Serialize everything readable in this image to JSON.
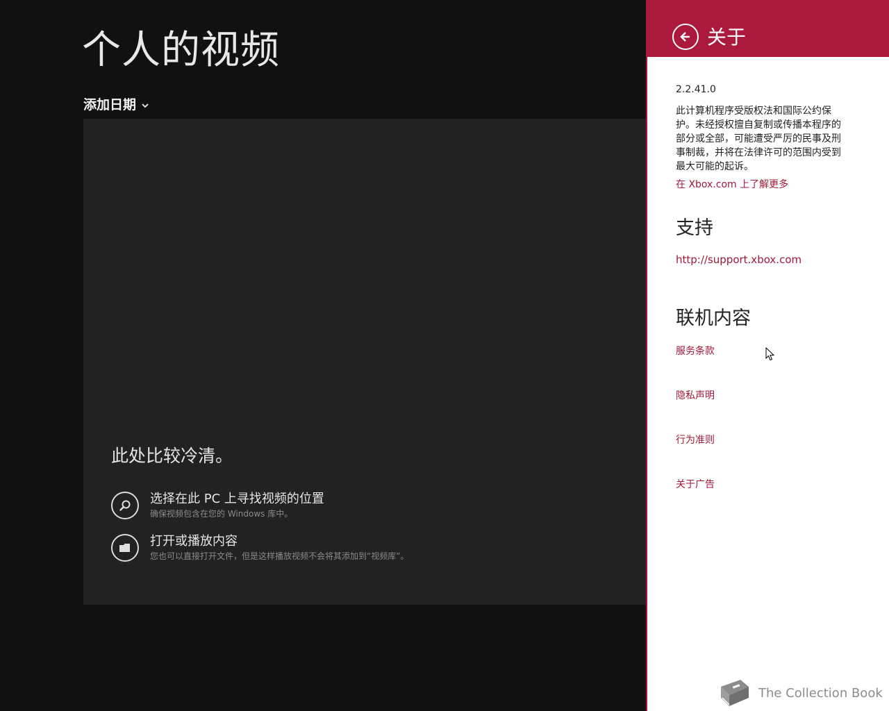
{
  "app": {
    "page_title": "个人的视频",
    "sort_label": "添加日期",
    "empty_state": {
      "title": "此处比较冷清。",
      "actions": [
        {
          "main": "选择在此 PC 上寻找视频的位置",
          "sub": "确保视频包含在您的 Windows 库中。",
          "icon": "search-icon"
        },
        {
          "main": "打开或播放内容",
          "sub": "您也可以直接打开文件，但是这样播放视频不会将其添加到“视频库”。",
          "icon": "folder-icon"
        }
      ]
    }
  },
  "about": {
    "title": "关于",
    "version": "2.2.41.0",
    "copyright": "此计算机程序受版权法和国际公约保护。未经授权擅自复制或传播本程序的部分或全部，可能遭受严厉的民事及刑事制裁，并将在法律许可的范围内受到最大可能的起诉。",
    "learn_more": "在 Xbox.com 上了解更多",
    "support_heading": "支持",
    "support_link": "http://support.xbox.com",
    "online_heading": "联机内容",
    "online_links": [
      "服务条款",
      "隐私声明",
      "行为准则",
      "关于广告"
    ]
  },
  "watermark": {
    "text": "The Collection Book",
    "icon": "book-icon"
  },
  "colors": {
    "accent": "#ab1a3c",
    "link": "#a0193a",
    "app_background": "#111111",
    "panel_background": "#222222"
  }
}
